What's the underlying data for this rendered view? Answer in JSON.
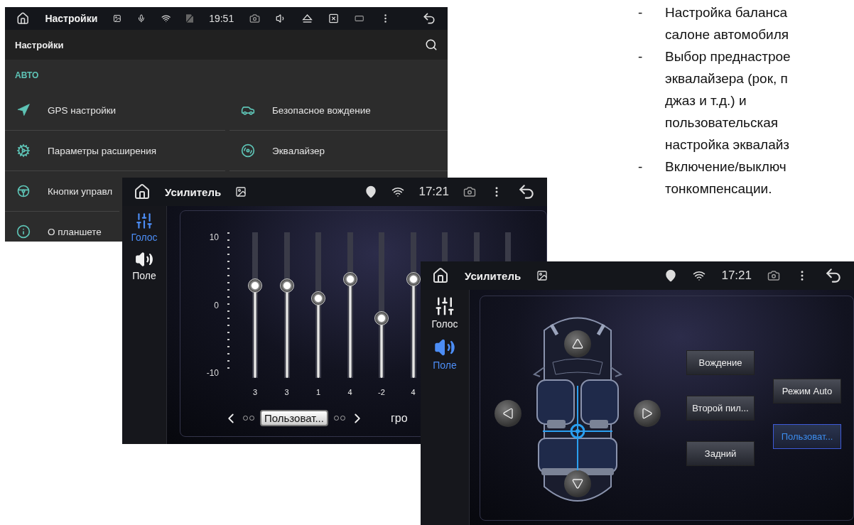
{
  "settings_window": {
    "status_bar": {
      "title": "Настройки",
      "time": "19:51"
    },
    "header": {
      "title": "Настройки"
    },
    "section": "АВТО",
    "rows": [
      [
        {
          "label": "GPS настройки",
          "kind": "gps"
        },
        {
          "label": "Безопасное вождение",
          "kind": "car"
        }
      ],
      [
        {
          "label": "Параметры расширения",
          "kind": "gears"
        },
        {
          "label": "Эквалайзер",
          "kind": "speaker"
        }
      ],
      [
        {
          "label": "Кнопки управл",
          "kind": "wheel"
        }
      ],
      [
        {
          "label": "О планшете",
          "kind": "info"
        }
      ]
    ]
  },
  "equalizer_window": {
    "status_bar": {
      "title": "Усилитель",
      "time": "17:21"
    },
    "side_tabs": [
      {
        "label": "Голос",
        "kind": "eq",
        "selected": true
      },
      {
        "label": "Поле",
        "kind": "speaker",
        "selected": false
      }
    ],
    "scale": [
      "10",
      "0",
      "-10"
    ],
    "bands": [
      {
        "value": "3",
        "level": 0.65
      },
      {
        "value": "3",
        "level": 0.65
      },
      {
        "value": "1",
        "level": 0.55
      },
      {
        "value": "4",
        "level": 0.7
      },
      {
        "value": "-2",
        "level": 0.4
      },
      {
        "value": "4",
        "level": 0.7
      }
    ],
    "preset": "Пользоват...",
    "next_label": "гро"
  },
  "balance_window": {
    "status_bar": {
      "title": "Усилитель",
      "time": "17:21"
    },
    "side_tabs": [
      {
        "label": "Голос",
        "kind": "eq",
        "selected": false
      },
      {
        "label": "Поле",
        "kind": "speaker",
        "selected": true
      }
    ],
    "mode_columns": [
      [
        {
          "label": "Вождение",
          "selected": false
        },
        {
          "label": "Второй пил...",
          "selected": false
        },
        {
          "label": "Задний",
          "selected": false
        }
      ],
      [
        {
          "label": "Режим Auto",
          "selected": false
        },
        {
          "label": "Пользоват...",
          "selected": true
        }
      ]
    ]
  },
  "notes": [
    {
      "marker": "-",
      "lines": [
        "Настройка баланса",
        "салоне автомобиля"
      ]
    },
    {
      "marker": "-",
      "lines": [
        "Выбор преднастрое",
        "эквалайзера (рок, п",
        "джаз и т.д.) и",
        "пользовательская",
        "настройка эквалайз"
      ]
    },
    {
      "marker": "-",
      "lines": [
        "Включение/выключ",
        "тонкомпенсации."
      ]
    }
  ]
}
